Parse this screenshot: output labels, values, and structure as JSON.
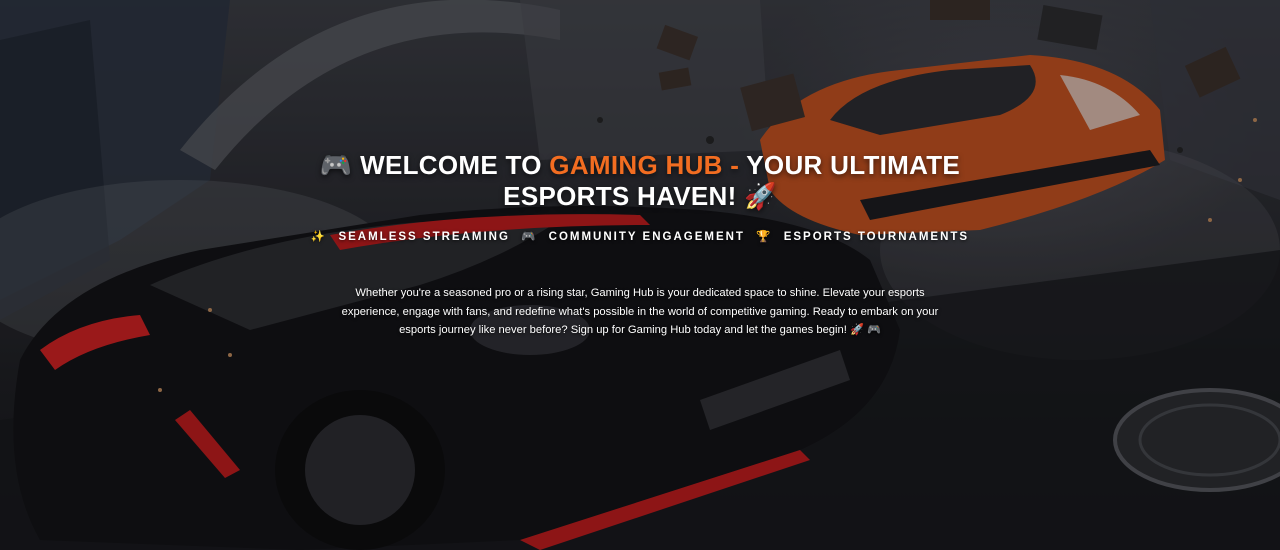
{
  "hero": {
    "title": {
      "emoji_left": "🎮",
      "prefix": "WELCOME TO ",
      "brand": "GAMING HUB -",
      "suffix": " YOUR ULTIMATE ESPORTS HAVEN!",
      "emoji_right": "🚀",
      "accent_color": "#f26d21"
    },
    "features": [
      {
        "emoji": "✨",
        "label": "SEAMLESS STREAMING"
      },
      {
        "emoji": "🎮",
        "label": "COMMUNITY ENGAGEMENT"
      },
      {
        "emoji": "🏆",
        "label": "ESPORTS TOURNAMENTS"
      }
    ],
    "description": {
      "text": "Whether you're a seasoned pro or a rising star, Gaming Hub is your dedicated space to shine. Elevate your esports experience, engage with fans, and redefine what's possible in the world of competitive gaming. Ready to embark on your esports journey like never before? Sign up for Gaming Hub today and let the games begin!",
      "emojis": "🚀 🎮"
    },
    "background_image": "racing-cars-explosion-scene"
  }
}
